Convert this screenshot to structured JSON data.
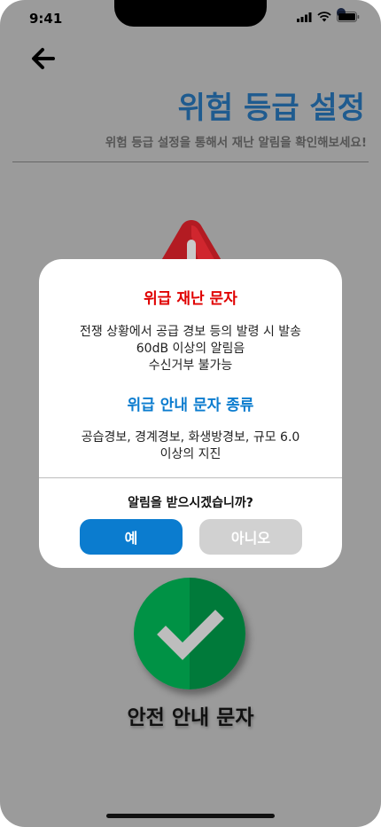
{
  "status_bar": {
    "time": "9:41"
  },
  "header": {
    "title": "위험 등급 설정",
    "subtitle": "위험 등급 설정을 통해서 재난 알림을 확인해보세요!"
  },
  "background": {
    "safe_label": "안전 안내 문자"
  },
  "modal": {
    "emergency_title": "위급 재난 문자",
    "emergency_line1": "전쟁 상황에서 공급 경보 등의 발령 시 발송",
    "emergency_line2": "60dB 이상의 알림음",
    "emergency_line3": "수신거부 불가능",
    "types_title": "위급 안내 문자 종류",
    "types_line1": "공습경보, 경계경보, 화생방경보, 규모 6.0",
    "types_line2": "이상의 지진",
    "question": "알림을 받으시겠습니까?",
    "yes_label": "예",
    "no_label": "아니오"
  },
  "colors": {
    "title_blue": "#1f5b8f",
    "emergency_red": "#e00000",
    "types_blue": "#0b7ccf",
    "yes_button": "#0b7ccf",
    "no_button": "#d1d1d1",
    "check_green": "#009245"
  }
}
